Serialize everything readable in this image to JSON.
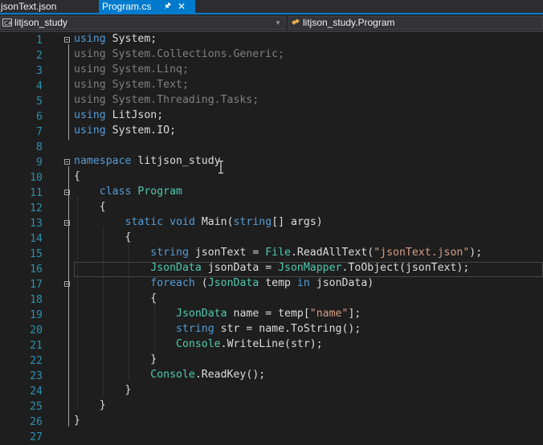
{
  "tabs": [
    {
      "label": "jsonText.json",
      "active": false
    },
    {
      "label": "Program.cs",
      "active": true,
      "pin_icon": "pin-icon",
      "close_icon": "close-icon"
    }
  ],
  "nav": {
    "project": "litjson_study",
    "class_member": "litjson_study.Program"
  },
  "colors": {
    "keyword": "#569cd6",
    "type": "#4ec9b0",
    "string": "#d69d85",
    "line_number": "#2b91af",
    "accent": "#007acc"
  },
  "editor": {
    "line_numbers": [
      "1",
      "2",
      "3",
      "4",
      "5",
      "6",
      "7",
      "8",
      "9",
      "10",
      "11",
      "12",
      "13",
      "14",
      "15",
      "16",
      "17",
      "18",
      "19",
      "20",
      "21",
      "22",
      "23",
      "24",
      "25",
      "26",
      "27"
    ],
    "lines": {
      "l1": {
        "kw": "using",
        "rest": " System;"
      },
      "l2": {
        "text": "using System.Collections.Generic;"
      },
      "l3": {
        "text": "using System.Linq;"
      },
      "l4": {
        "text": "using System.Text;"
      },
      "l5": {
        "text": "using System.Threading.Tasks;"
      },
      "l6": {
        "kw": "using",
        "rest": " LitJson;"
      },
      "l7": {
        "kw": "using",
        "rest": " System.IO;"
      },
      "l9": {
        "kw": "namespace",
        "rest": " litjson_study"
      },
      "l10": {
        "text": "{"
      },
      "l11": {
        "kw": "class",
        "ty": "Program"
      },
      "l12": {
        "text": "{"
      },
      "l13": {
        "kw1": "static",
        "kw2": "void",
        "name": "Main(",
        "kw3": "string",
        "rest": "[] args)"
      },
      "l14": {
        "text": "{"
      },
      "l15": {
        "kw": "string",
        "mid": " jsonText = ",
        "ty": "File",
        "call": ".ReadAllText(",
        "str": "\"jsonText.json\"",
        "end": ");"
      },
      "l16": {
        "ty1": "JsonData",
        "mid": " jsonData = ",
        "ty2": "JsonMapper",
        "end": ".ToObject(jsonText);"
      },
      "l17": {
        "kw": "foreach",
        "open": " (",
        "ty": "JsonData",
        "mid": " temp ",
        "kw2": "in",
        "end": " jsonData)"
      },
      "l18": {
        "text": "{"
      },
      "l19": {
        "ty": "JsonData",
        "mid": " name = temp[",
        "str": "\"name\"",
        "end": "];"
      },
      "l20": {
        "kw": "string",
        "end": " str = name.ToString();"
      },
      "l21": {
        "ty": "Console",
        "end": ".WriteLine(str);"
      },
      "l22": {
        "text": "}"
      },
      "l23": {
        "ty": "Console",
        "end": ".ReadKey();"
      },
      "l24": {
        "text": "}"
      },
      "l25": {
        "text": "}"
      },
      "l26": {
        "text": "}"
      }
    },
    "cursor_icon": "ibeam-cursor-icon"
  }
}
